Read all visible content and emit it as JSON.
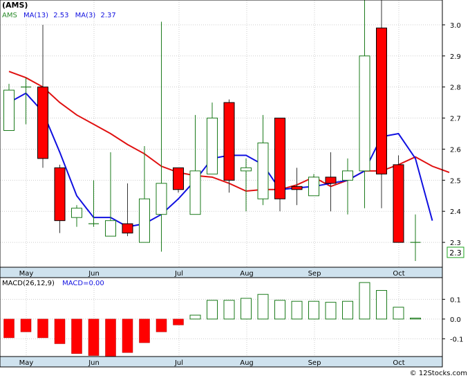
{
  "chart_data": [
    {
      "type": "candlestick",
      "symbol": "(AMS)",
      "legend": [
        {
          "label": "AMS",
          "color": "#000000"
        },
        {
          "label": "MA(13)",
          "value": "2.53",
          "color": "#e01010"
        },
        {
          "label": "MA(3)",
          "value": "2.37",
          "color": "#1010e0"
        }
      ],
      "last_price_label": "2.3",
      "x_tick_labels": [
        "May",
        "Jun",
        "Jul",
        "Aug",
        "Sep",
        "Oct"
      ],
      "y_tick_labels": [
        "2.3",
        "2.4",
        "2.5",
        "2.6",
        "2.7",
        "2.8",
        "2.9",
        "3.0"
      ],
      "ylim": [
        2.22,
        3.08
      ],
      "grid": true,
      "candles": [
        {
          "o": 2.66,
          "h": 2.81,
          "l": 2.66,
          "c": 2.79
        },
        {
          "o": 2.8,
          "h": 2.83,
          "l": 2.68,
          "c": 2.8
        },
        {
          "o": 2.8,
          "h": 3.0,
          "l": 2.54,
          "c": 2.57
        },
        {
          "o": 2.54,
          "h": 2.55,
          "l": 2.33,
          "c": 2.37
        },
        {
          "o": 2.38,
          "h": 2.42,
          "l": 2.35,
          "c": 2.41
        },
        {
          "o": 2.36,
          "h": 2.5,
          "l": 2.35,
          "c": 2.36
        },
        {
          "o": 2.32,
          "h": 2.59,
          "l": 2.32,
          "c": 2.37
        },
        {
          "o": 2.36,
          "h": 2.49,
          "l": 2.32,
          "c": 2.33
        },
        {
          "o": 2.3,
          "h": 2.61,
          "l": 2.3,
          "c": 2.44
        },
        {
          "o": 2.39,
          "h": 3.01,
          "l": 2.27,
          "c": 2.49
        },
        {
          "o": 2.54,
          "h": 2.54,
          "l": 2.46,
          "c": 2.47
        },
        {
          "o": 2.39,
          "h": 2.71,
          "l": 2.39,
          "c": 2.53
        },
        {
          "o": 2.52,
          "h": 2.75,
          "l": 2.52,
          "c": 2.7
        },
        {
          "o": 2.75,
          "h": 2.76,
          "l": 2.46,
          "c": 2.5
        },
        {
          "o": 2.53,
          "h": 2.57,
          "l": 2.4,
          "c": 2.54
        },
        {
          "o": 2.44,
          "h": 2.71,
          "l": 2.42,
          "c": 2.62
        },
        {
          "o": 2.7,
          "h": 2.7,
          "l": 2.4,
          "c": 2.44
        },
        {
          "o": 2.48,
          "h": 2.54,
          "l": 2.42,
          "c": 2.47
        },
        {
          "o": 2.45,
          "h": 2.52,
          "l": 2.45,
          "c": 2.51
        },
        {
          "o": 2.51,
          "h": 2.59,
          "l": 2.4,
          "c": 2.49
        },
        {
          "o": 2.5,
          "h": 2.57,
          "l": 2.39,
          "c": 2.53
        },
        {
          "o": 2.53,
          "h": 3.08,
          "l": 2.41,
          "c": 2.9
        },
        {
          "o": 2.99,
          "h": 3.08,
          "l": 2.41,
          "c": 2.52
        },
        {
          "o": 2.55,
          "h": 2.58,
          "l": 2.3,
          "c": 2.3
        },
        {
          "o": 2.3,
          "h": 2.39,
          "l": 2.24,
          "c": 2.3
        }
      ],
      "ma13": [
        2.85,
        2.83,
        2.8,
        2.75,
        2.71,
        2.68,
        2.65,
        2.615,
        2.585,
        2.545,
        2.525,
        2.515,
        2.51,
        2.49,
        2.465,
        2.47,
        2.47,
        2.485,
        2.51,
        2.48,
        2.5,
        2.53,
        2.53,
        2.55,
        2.575,
        2.545,
        2.525
      ],
      "ma3": [
        2.75,
        2.78,
        2.72,
        2.59,
        2.45,
        2.38,
        2.38,
        2.35,
        2.36,
        2.39,
        2.44,
        2.5,
        2.57,
        2.58,
        2.58,
        2.55,
        2.47,
        2.475,
        2.48,
        2.49,
        2.5,
        2.53,
        2.64,
        2.65,
        2.57,
        2.37
      ]
    },
    {
      "type": "bar",
      "title": "MACD(26,12,9)",
      "legend": [
        {
          "label": "MACD=0.00",
          "color": "#1010e0"
        }
      ],
      "x_tick_labels": [
        "May",
        "Jun",
        "Jul",
        "Aug",
        "Sep",
        "Oct"
      ],
      "y_tick_labels": [
        "0.1",
        "0.0",
        "-0.1"
      ],
      "ylim": [
        -0.19,
        0.21
      ],
      "values": [
        -0.095,
        -0.065,
        -0.095,
        -0.125,
        -0.175,
        -0.185,
        -0.195,
        -0.17,
        -0.12,
        -0.065,
        -0.03,
        0.02,
        0.095,
        0.095,
        0.105,
        0.125,
        0.095,
        0.09,
        0.09,
        0.085,
        0.09,
        0.185,
        0.145,
        0.06,
        0.005
      ]
    }
  ],
  "footer": {
    "copyright": "© 12Stocks.com"
  }
}
